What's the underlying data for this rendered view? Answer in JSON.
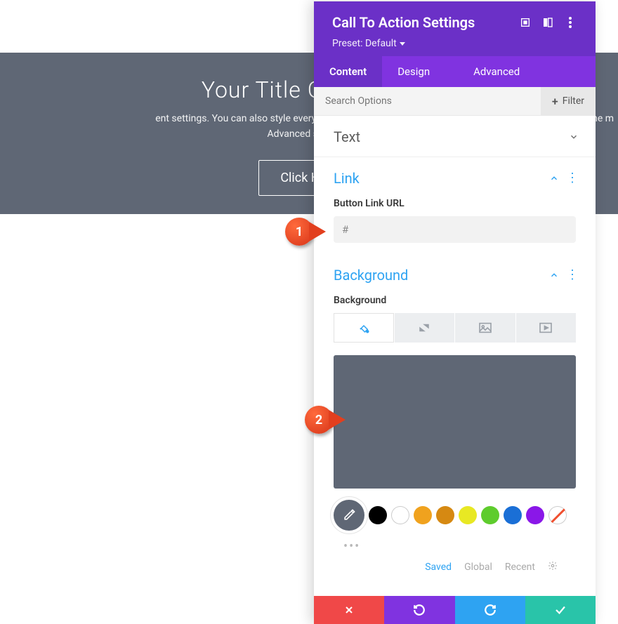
{
  "hero": {
    "title": "Your Title Goes Here",
    "desc_line1": "ent settings. You can also style every aspect of this content in the mod",
    "desc_line2": "Advanced settings.",
    "desc_right": "he m",
    "button": "Click Here"
  },
  "panel": {
    "title": "Call To Action Settings",
    "preset": "Preset: Default",
    "tabs": {
      "content": "Content",
      "design": "Design",
      "advanced": "Advanced"
    },
    "search_placeholder": "Search Options",
    "filter_label": "Filter"
  },
  "sections": {
    "text": "Text",
    "link": {
      "title": "Link",
      "field_label": "Button Link URL",
      "value": "#"
    },
    "background": {
      "title": "Background",
      "field_label": "Background",
      "preview_color": "#5f6775",
      "palette_tabs": {
        "saved": "Saved",
        "global": "Global",
        "recent": "Recent"
      },
      "swatches": [
        "#000000",
        "#ffffff",
        "#f0a21e",
        "#d68912",
        "#e8e823",
        "#5ecc2d",
        "#1a6fd6",
        "#8a17e8"
      ]
    }
  },
  "callouts": {
    "a": "1",
    "b": "2"
  }
}
